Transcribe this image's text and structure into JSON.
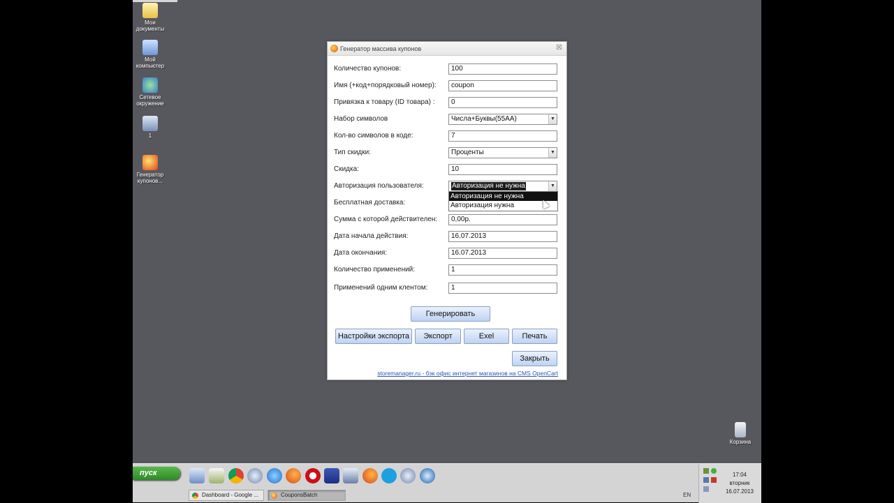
{
  "desktop": {
    "icons": [
      {
        "label": "Мои документы",
        "icon": "folder-documents-icon"
      },
      {
        "label": "Мой компьютер",
        "icon": "computer-icon"
      },
      {
        "label": "Сетевое окружение",
        "icon": "network-icon"
      },
      {
        "label": "1",
        "icon": "network-computer-icon"
      },
      {
        "label": "Генератор купонов...",
        "icon": "coupon-generator-icon"
      },
      {
        "label": "Корзина",
        "icon": "recycle-bin-icon"
      }
    ]
  },
  "dialog": {
    "title": "Генератор массива купонов",
    "close_glyph": "☒",
    "fields": [
      {
        "label": "Количество купонов:",
        "value": "100",
        "kind": "text"
      },
      {
        "label": "Имя (+код+порядковый номер):",
        "value": "coupon",
        "kind": "text"
      },
      {
        "label": "Привязка к товару (ID товара) :",
        "value": "0",
        "kind": "text"
      },
      {
        "label": "Набор символов",
        "value": "Числа+Буквы(55AA)",
        "kind": "select"
      },
      {
        "label": "Кол-во символов в коде:",
        "value": "7",
        "kind": "text"
      },
      {
        "label": "Тип скидки:",
        "value": "Проценты",
        "kind": "select"
      },
      {
        "label": "Скидка:",
        "value": "10",
        "kind": "text"
      },
      {
        "label": "Авторизация пользователя:",
        "value": "Авторизация не нужна",
        "kind": "select"
      },
      {
        "label": "Бесплатная доставка:",
        "value": "",
        "kind": "select"
      },
      {
        "label": "Сумма с которой действителен:",
        "value": "0,00р.",
        "kind": "text"
      },
      {
        "label": "Дата начала действия:",
        "value": "16.07.2013",
        "kind": "text"
      },
      {
        "label": "Дата окончания:",
        "value": "16.07.2013",
        "kind": "text"
      },
      {
        "label": "Количество применений:",
        "value": "1",
        "kind": "text"
      },
      {
        "label": "Применений одним клентом:",
        "value": "1",
        "kind": "text"
      }
    ],
    "dropdown_options": [
      "Авторизация не нужна",
      "Авторизация нужна"
    ],
    "buttons": {
      "generate": "Генерировать",
      "export_settings": "Настройки экспорта",
      "export": "Экспорт",
      "excel": "Exel",
      "print": "Печать",
      "close": "Закрыть"
    },
    "footer_link": "storemanager.ru - бэк офис интернет магазинов на CMS OpenCart"
  },
  "taskbar": {
    "start_label": "пуск",
    "quick_launch": [
      "show-desktop-icon",
      "notepad-icon",
      "chrome-icon",
      "media-icon",
      "ie-icon",
      "firefox-icon",
      "opera-icon",
      "save-icon",
      "network-icon",
      "firefox-icon",
      "skype-icon",
      "media-icon",
      "thunderbird-icon"
    ],
    "tasks": [
      {
        "label": "Dashboard - Google ...",
        "icon": "chrome-icon"
      },
      {
        "label": "CouponsBatch",
        "icon": "coupon-generator-icon"
      }
    ],
    "language": "EN",
    "clock": {
      "time": "17:04",
      "day": "вторник",
      "date": "16.07.2013"
    }
  }
}
